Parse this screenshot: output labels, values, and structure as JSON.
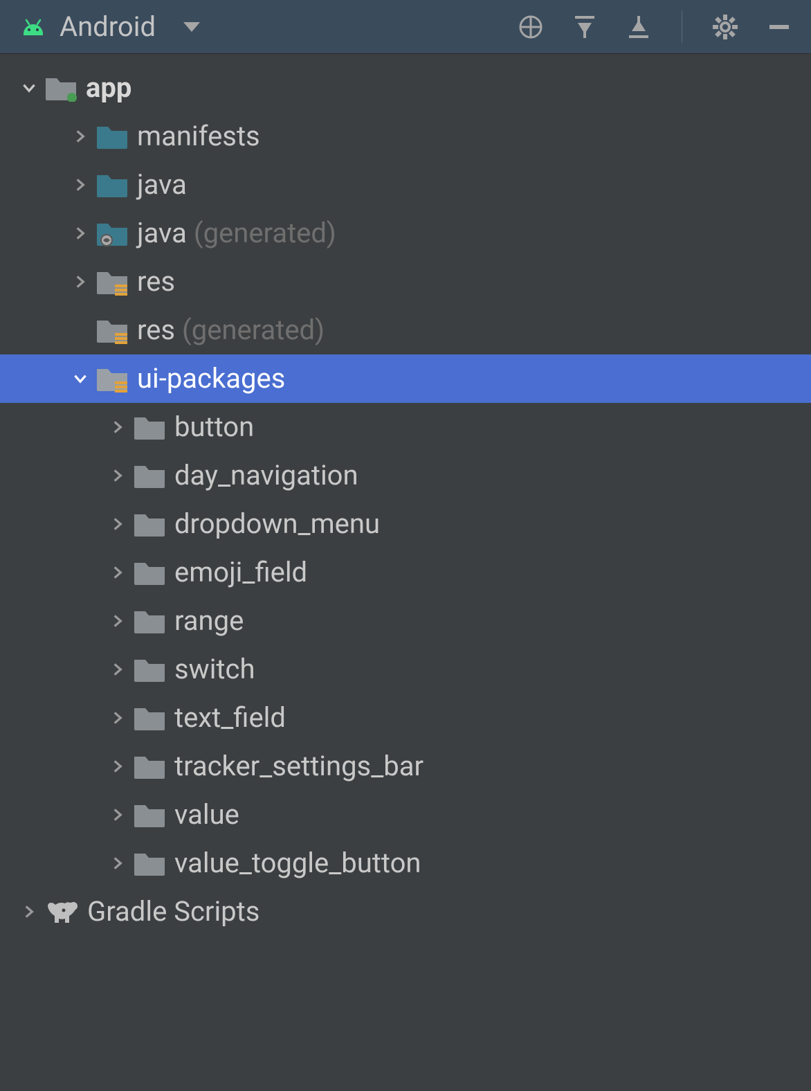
{
  "toolbar": {
    "title": "Android"
  },
  "tree": {
    "app": {
      "label": "app",
      "children": {
        "manifests": {
          "label": "manifests"
        },
        "java": {
          "label": "java"
        },
        "java_gen": {
          "label": "java",
          "suffix": "(generated)"
        },
        "res": {
          "label": "res"
        },
        "res_gen": {
          "label": "res",
          "suffix": "(generated)"
        },
        "ui_packages": {
          "label": "ui-packages",
          "children": [
            {
              "label": "button"
            },
            {
              "label": "day_navigation"
            },
            {
              "label": "dropdown_menu"
            },
            {
              "label": "emoji_field"
            },
            {
              "label": "range"
            },
            {
              "label": "switch"
            },
            {
              "label": "text_field"
            },
            {
              "label": "tracker_settings_bar"
            },
            {
              "label": "value"
            },
            {
              "label": "value_toggle_button"
            }
          ]
        }
      }
    },
    "gradle": {
      "label": "Gradle Scripts"
    }
  }
}
